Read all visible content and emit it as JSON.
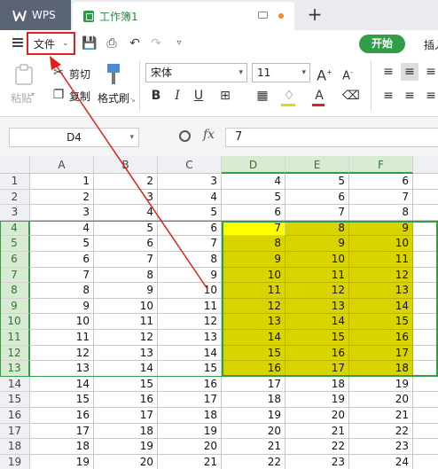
{
  "titlebar": {
    "app_tab": "WPS",
    "doc_tab": "工作簿1",
    "new_tab": "+"
  },
  "menubar": {
    "file_menu": "文件",
    "start_tab": "开始",
    "insert_tab": "插入"
  },
  "ribbon": {
    "paste": "粘贴",
    "cut": "剪切",
    "copy": "复制",
    "format_painter": "格式刷",
    "font_name": "宋体",
    "font_size": "11",
    "bold": "B",
    "italic": "I",
    "underline": "U"
  },
  "formula_bar": {
    "cell_ref": "D4",
    "fx": "fx",
    "value": "7"
  },
  "grid": {
    "columns": [
      "A",
      "B",
      "C",
      "D",
      "E",
      "F"
    ],
    "rows": [
      {
        "n": "1",
        "cells": [
          "1",
          "2",
          "3",
          "4",
          "5",
          "6"
        ]
      },
      {
        "n": "2",
        "cells": [
          "2",
          "3",
          "4",
          "5",
          "6",
          "7"
        ]
      },
      {
        "n": "3",
        "cells": [
          "3",
          "4",
          "5",
          "6",
          "7",
          "8"
        ]
      },
      {
        "n": "4",
        "cells": [
          "4",
          "5",
          "6",
          "7",
          "8",
          "9"
        ]
      },
      {
        "n": "5",
        "cells": [
          "5",
          "6",
          "7",
          "8",
          "9",
          "10"
        ]
      },
      {
        "n": "6",
        "cells": [
          "6",
          "7",
          "8",
          "9",
          "10",
          "11"
        ]
      },
      {
        "n": "7",
        "cells": [
          "7",
          "8",
          "9",
          "10",
          "11",
          "12"
        ]
      },
      {
        "n": "8",
        "cells": [
          "8",
          "9",
          "10",
          "11",
          "12",
          "13"
        ]
      },
      {
        "n": "9",
        "cells": [
          "9",
          "10",
          "11",
          "12",
          "13",
          "14"
        ]
      },
      {
        "n": "10",
        "cells": [
          "10",
          "11",
          "12",
          "13",
          "14",
          "15"
        ]
      },
      {
        "n": "11",
        "cells": [
          "11",
          "12",
          "13",
          "14",
          "15",
          "16"
        ]
      },
      {
        "n": "12",
        "cells": [
          "12",
          "13",
          "14",
          "15",
          "16",
          "17"
        ]
      },
      {
        "n": "13",
        "cells": [
          "13",
          "14",
          "15",
          "16",
          "17",
          "18"
        ]
      },
      {
        "n": "14",
        "cells": [
          "14",
          "15",
          "16",
          "17",
          "18",
          "19"
        ]
      },
      {
        "n": "15",
        "cells": [
          "15",
          "16",
          "17",
          "18",
          "19",
          "20"
        ]
      },
      {
        "n": "16",
        "cells": [
          "16",
          "17",
          "18",
          "19",
          "20",
          "21"
        ]
      },
      {
        "n": "17",
        "cells": [
          "17",
          "18",
          "19",
          "20",
          "21",
          "22"
        ]
      },
      {
        "n": "18",
        "cells": [
          "18",
          "19",
          "20",
          "21",
          "22",
          "23"
        ]
      },
      {
        "n": "19",
        "cells": [
          "19",
          "20",
          "21",
          "22",
          "23",
          "24"
        ]
      }
    ],
    "selection": "D4:F13",
    "active_cell": "D4"
  },
  "colors": {
    "highlight": "#d9d400",
    "active_cell": "#ffff00",
    "selection_border": "#2f9e44",
    "annotation": "#e0201c"
  }
}
